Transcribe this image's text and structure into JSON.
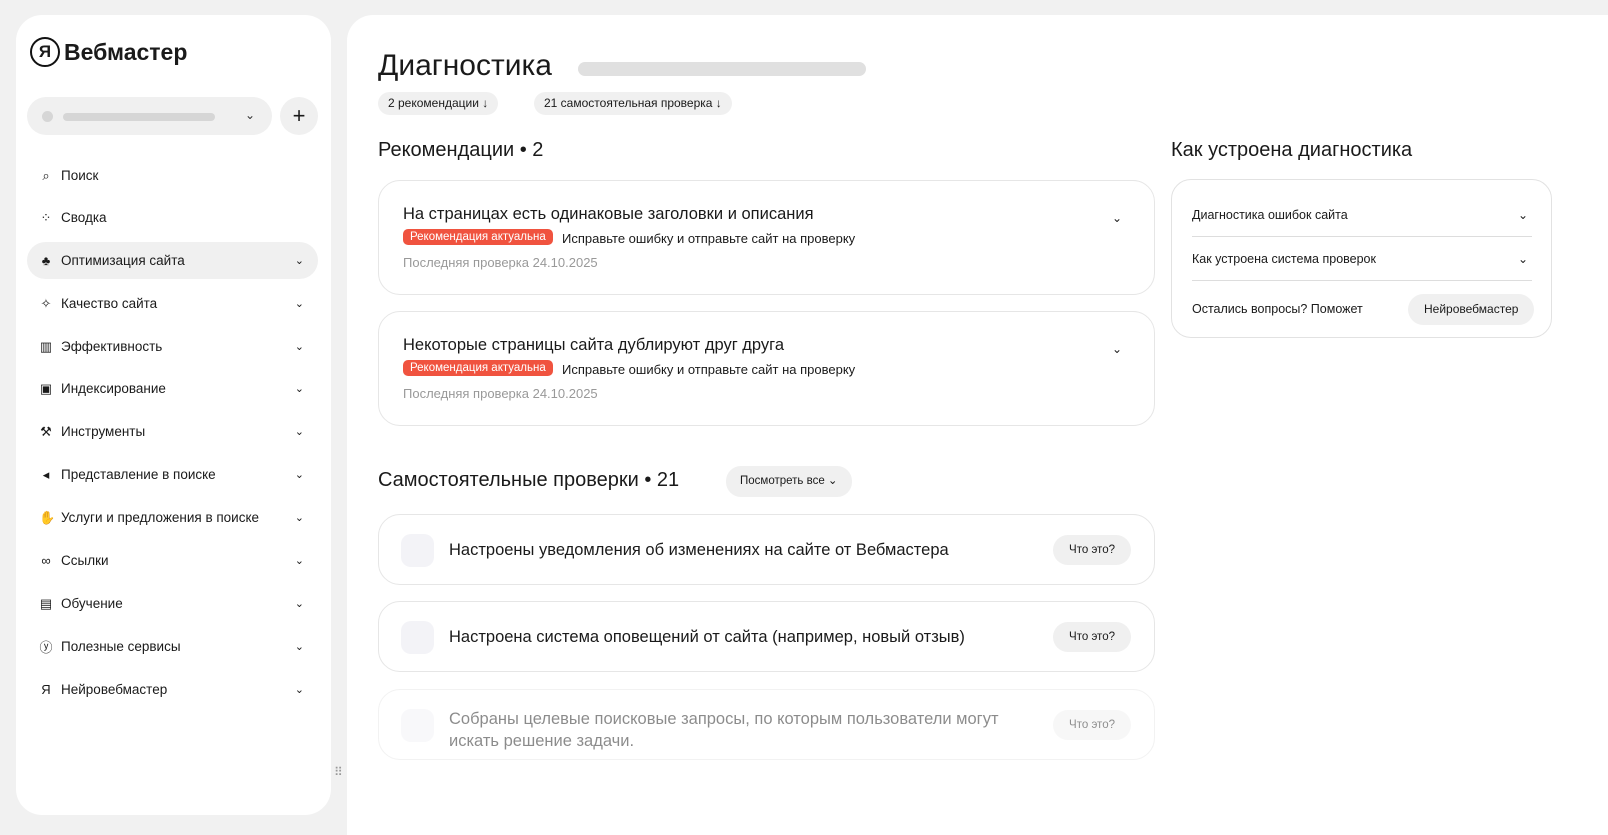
{
  "sidebar": {
    "logo": "Вебмастер",
    "logo_letter": "Я",
    "items": [
      {
        "label": "Поиск",
        "icon": "⌕"
      },
      {
        "label": "Сводка",
        "icon": "⁘"
      },
      {
        "label": "Оптимизация сайта",
        "icon": "♣"
      },
      {
        "label": "Качество сайта",
        "icon": "✧"
      },
      {
        "label": "Эффективность",
        "icon": "▥"
      },
      {
        "label": "Индексирование",
        "icon": "▣"
      },
      {
        "label": "Инструменты",
        "icon": "⚒"
      },
      {
        "label": "Представление в поиске",
        "icon": "◂"
      },
      {
        "label": "Услуги и предложения в поиске",
        "icon": "✋"
      },
      {
        "label": "Ссылки",
        "icon": "∞"
      },
      {
        "label": "Обучение",
        "icon": "▤"
      },
      {
        "label": "Полезные сервисы",
        "icon": "ⓨ"
      },
      {
        "label": "Нейровебмастер",
        "icon": "Я"
      }
    ]
  },
  "header": {
    "title": "Диагностика",
    "chips": [
      "2 рекомендации ↓",
      "21 самостоятельная проверка ↓"
    ]
  },
  "recommendations": {
    "heading": "Рекомендации • 2",
    "items": [
      {
        "title": "На страницах есть одинаковые заголовки и описания",
        "badge": "Рекомендация актуальна",
        "desc": "Исправьте ошибку и отправьте сайт на проверку",
        "date": "Последняя проверка 24.10.2025"
      },
      {
        "title": "Некоторые страницы сайта дублируют друг друга",
        "badge": "Рекомендация актуальна",
        "desc": "Исправьте ошибку и отправьте сайт на проверку",
        "date": "Последняя проверка 24.10.2025"
      }
    ]
  },
  "checks": {
    "heading": "Самостоятельные проверки • 21",
    "view_all": "Посмотреть все",
    "what_label": "Что это?",
    "items": [
      "Настроены уведомления об изменениях на сайте от Вебмастера",
      "Настроена система оповещений от сайта (например, новый отзыв)",
      "Собраны целевые поисковые запросы, по которым пользователи могут искать решение задачи."
    ]
  },
  "help": {
    "heading": "Как устроена диагностика",
    "items": [
      "Диагностика ошибок сайта",
      "Как устроена система проверок"
    ],
    "question": "Остались вопросы? Поможет",
    "button": "Нейровебмастер"
  },
  "colors": {
    "badge": "#f0533f"
  }
}
